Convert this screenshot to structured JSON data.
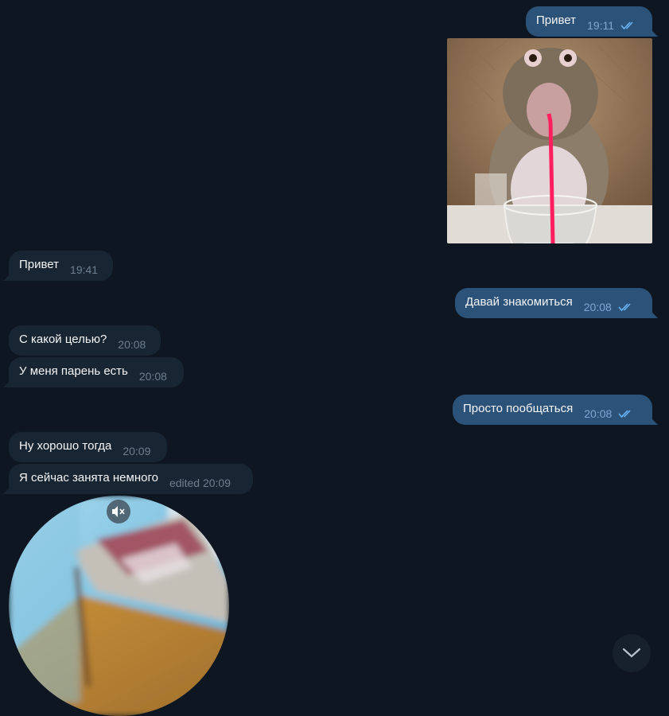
{
  "messages": [
    {
      "id": "m1",
      "direction": "outgoing",
      "text": "Привет",
      "time": "19:11",
      "read": true
    },
    {
      "id": "m2",
      "direction": "outgoing",
      "type": "photo",
      "content": "monkey drinking through a pink straw"
    },
    {
      "id": "m3",
      "direction": "incoming",
      "text": "Привет",
      "time": "19:41"
    },
    {
      "id": "m4",
      "direction": "outgoing",
      "text": "Давай знакомиться",
      "time": "20:08",
      "read": true
    },
    {
      "id": "m5",
      "direction": "incoming",
      "text": "С какой целью?",
      "time": "20:08"
    },
    {
      "id": "m6",
      "direction": "incoming",
      "text": "У меня парень есть",
      "time": "20:08"
    },
    {
      "id": "m7",
      "direction": "outgoing",
      "text": "Просто пообщаться",
      "time": "20:08",
      "read": true
    },
    {
      "id": "m8",
      "direction": "incoming",
      "text": "Ну хорошо тогда",
      "time": "20:09"
    },
    {
      "id": "m9",
      "direction": "incoming",
      "text": "Я сейчас занята немного",
      "time": "edited 20:09"
    },
    {
      "id": "m10",
      "direction": "incoming",
      "type": "video_note",
      "muted": true
    }
  ],
  "icons": {
    "read_ticks": "double-check-icon",
    "mute": "speaker-muted-icon",
    "scroll_down": "chevron-down-icon"
  },
  "colors": {
    "background": "#0e1621",
    "incoming_bubble": "#182533",
    "outgoing_bubble": "#2b5278",
    "incoming_meta": "#6d7f8f",
    "outgoing_meta": "#7da8d3"
  }
}
